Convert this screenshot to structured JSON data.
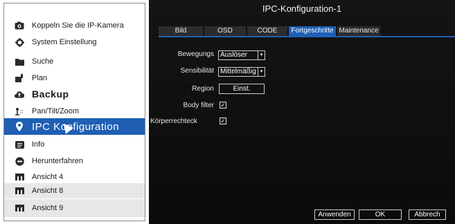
{
  "menu": {
    "items": [
      {
        "label": "Koppeln Sie die IP-Kamera",
        "icon": "camera-icon"
      },
      {
        "label": "System Einstellung",
        "icon": "gear-icon"
      },
      {
        "label": "Suche",
        "icon": "search-folder-icon"
      },
      {
        "label": "Plan",
        "icon": "plan-icon"
      },
      {
        "label": "Backup",
        "icon": "cloud-upload-icon"
      },
      {
        "label": "Pan/Tilt/Zoom",
        "icon": "ptz-icon"
      },
      {
        "label": "IPC Konfiguration",
        "icon": "location-pin-icon"
      },
      {
        "label": "Info",
        "icon": "info-icon"
      },
      {
        "label": "Herunterfahren",
        "icon": "power-icon"
      },
      {
        "label": "Ansicht 4",
        "icon": "grid-icon"
      },
      {
        "label": "Ansicht 8",
        "icon": "grid-icon"
      },
      {
        "label": "Ansicht 9",
        "icon": "grid-icon"
      }
    ]
  },
  "panel": {
    "title": "IPC-Konfiguration-1",
    "tabs": [
      "Bild",
      "OSD",
      "CODE",
      "Fortgeschritte",
      "Maintenance"
    ],
    "active_tab": "Fortgeschritte",
    "fields": {
      "motion_label": "Bewegungs",
      "motion_value": "Auslöser",
      "sensitivity_label": "Sensibilität",
      "sensitivity_value": "Mittelmäßig",
      "region_label": "Region",
      "region_button": "Einst.",
      "body_filter_label": "Body filter",
      "body_filter_checked": true,
      "body_rect_label": "Körperrechteck",
      "body_rect_checked": true
    },
    "buttons": {
      "apply": "Anwenden",
      "ok": "OK",
      "cancel": "Abbrech"
    }
  },
  "colors": {
    "accent": "#1f5fb4",
    "panel_bg": "#111111",
    "menu_stripe": "#e7e7e7"
  }
}
